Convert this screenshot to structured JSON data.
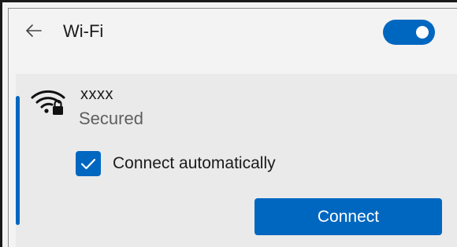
{
  "header": {
    "back_icon": "arrow-left-icon",
    "title": "Wi-Fi",
    "toggle_state": "on"
  },
  "network": {
    "icon": "wifi-secured-icon",
    "ssid": "xxxx",
    "status": "Secured",
    "connect_automatically_label": "Connect automatically",
    "connect_automatically_checked": true,
    "connect_button_label": "Connect"
  },
  "colors": {
    "accent": "#0067c0",
    "background": "#f3f3f3",
    "item_background": "#eaeaea",
    "secondary_text": "#5f5f5f"
  }
}
